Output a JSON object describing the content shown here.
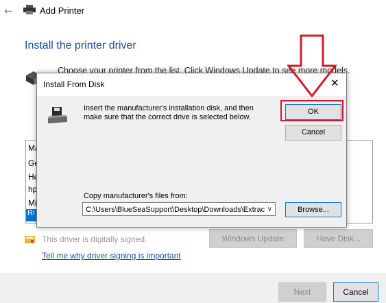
{
  "wizard": {
    "title": "Add Printer",
    "heading": "Install the printer driver",
    "instructions": "Choose your printer from the list. Click Windows Update to see more models.",
    "manufacturers": [
      "Ma",
      "Ge",
      "He",
      "hp",
      "Mi",
      "Ri"
    ],
    "signed_text": "This driver is digitally signed.",
    "why_link": "Tell me why driver signing is important",
    "windows_update_label": "Windows Update",
    "have_disk_label": "Have Disk...",
    "next_label": "Next",
    "cancel_label": "Cancel"
  },
  "dialog": {
    "title": "Install From Disk",
    "message": "Insert the manufacturer's installation disk, and then make sure that the correct drive is selected below.",
    "ok_label": "OK",
    "cancel_label": "Cancel",
    "copy_label": "Copy manufacturer's files from:",
    "path_value": "C:\\Users\\BlueSeaSupport\\Desktop\\Downloads\\Extrac",
    "browse_label": "Browse..."
  },
  "colors": {
    "accent": "#0078d7",
    "heading": "#1a4d9e",
    "highlight": "#d21a2b"
  },
  "icons": {
    "back": "back-arrow-icon",
    "printer": "printer-icon",
    "disk": "disk-drive-icon",
    "close": "close-icon",
    "annotation": "red-down-arrow-icon"
  }
}
